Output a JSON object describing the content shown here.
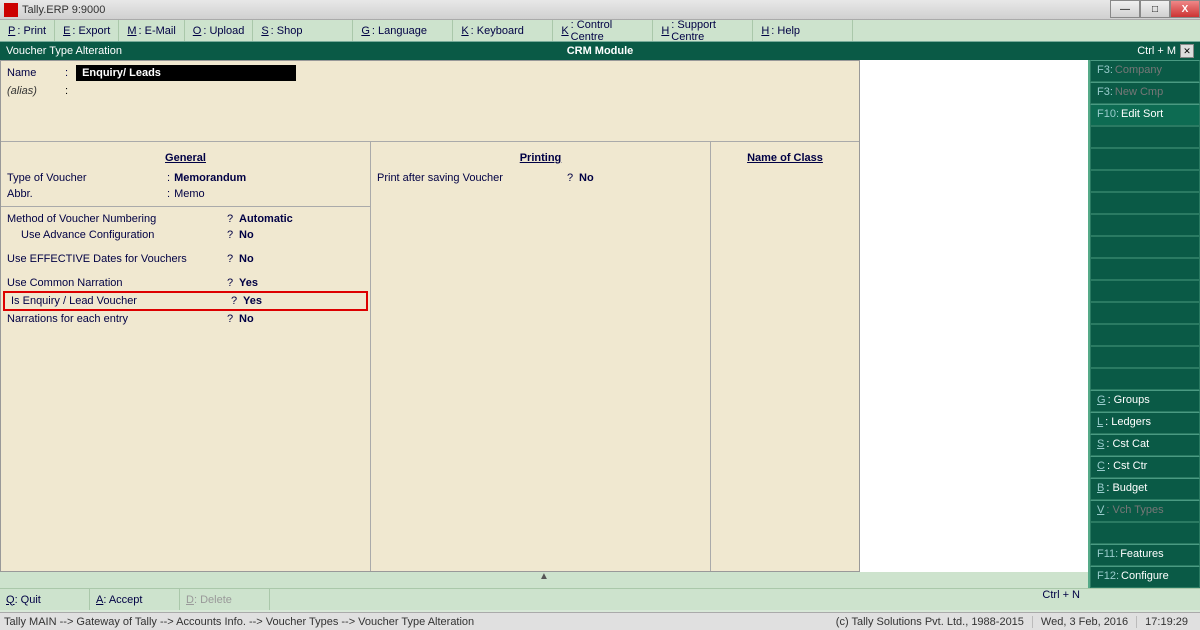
{
  "titlebar": {
    "text": "Tally.ERP 9:9000"
  },
  "win": {
    "min": "—",
    "max": "□",
    "close": "X"
  },
  "toolbar": [
    {
      "key": "P",
      "label": ": Print"
    },
    {
      "key": "E",
      "label": ": Export"
    },
    {
      "key": "M",
      "label": ": E-Mail"
    },
    {
      "key": "O",
      "label": ": Upload"
    },
    {
      "key": "S",
      "label": ": Shop"
    },
    {
      "key": "G",
      "label": ": Language"
    },
    {
      "key": "K",
      "label": ": Keyboard"
    },
    {
      "key": "K",
      "label": ": Control Centre"
    },
    {
      "key": "H",
      "label": ": Support Centre"
    },
    {
      "key": "H",
      "label": ": Help"
    }
  ],
  "header": {
    "title": "Voucher Type Alteration",
    "center": "CRM Module",
    "shortcut": "Ctrl + M"
  },
  "form": {
    "name_label": "Name",
    "name_value": "Enquiry/ Leads",
    "alias_label": "(alias)",
    "alias_value": ":",
    "col1_head": "General",
    "col2_head": "Printing",
    "col3_head": "Name of Class",
    "type_label": "Type of Voucher",
    "type_val": "Memorandum",
    "abbr_label": "Abbr.",
    "abbr_val": "Memo",
    "method_label": "Method of Voucher Numbering",
    "method_val": "Automatic",
    "advcfg_label": "Use Advance Configuration",
    "advcfg_val": "No",
    "effdate_label": "Use EFFECTIVE Dates for Vouchers",
    "effdate_val": "No",
    "common_label": "Use Common Narration",
    "common_val": "Yes",
    "enquiry_label": "Is Enquiry / Lead Voucher",
    "enquiry_val": "Yes",
    "narr_label": "Narrations for each entry",
    "narr_val": "No",
    "print_label": "Print after saving Voucher",
    "print_val": "No"
  },
  "right": [
    {
      "key": "F3:",
      "label": "Company",
      "disabled": true
    },
    {
      "key": "F3:",
      "label": "New Cmp",
      "disabled": true
    },
    {
      "key": "F10:",
      "label": "Edit Sort",
      "disabled": false
    }
  ],
  "right_bottom": [
    {
      "key": "G",
      "label": ": Groups"
    },
    {
      "key": "L",
      "label": ": Ledgers"
    },
    {
      "key": "S",
      "label": ": Cst Cat"
    },
    {
      "key": "C",
      "label": ": Cst Ctr"
    },
    {
      "key": "B",
      "label": ": Budget"
    },
    {
      "key": "V",
      "label": ": Vch Types"
    }
  ],
  "right_bottom2": [
    {
      "key": "F11:",
      "label": "Features"
    },
    {
      "key": "F12:",
      "label": "Configure"
    }
  ],
  "bottom": {
    "quit_key": "Q",
    "quit": ": Quit",
    "accept_key": "A",
    "accept": ": Accept",
    "delete_key": "D",
    "delete": ": Delete",
    "ctrln": "Ctrl + N"
  },
  "status": {
    "breadcrumb": "Tally MAIN --> Gateway of Tally --> Accounts Info. --> Voucher Types --> Voucher Type Alteration",
    "copyright": "(c) Tally Solutions Pvt. Ltd., 1988-2015",
    "date": "Wed, 3 Feb, 2016",
    "time": "17:19:29"
  }
}
